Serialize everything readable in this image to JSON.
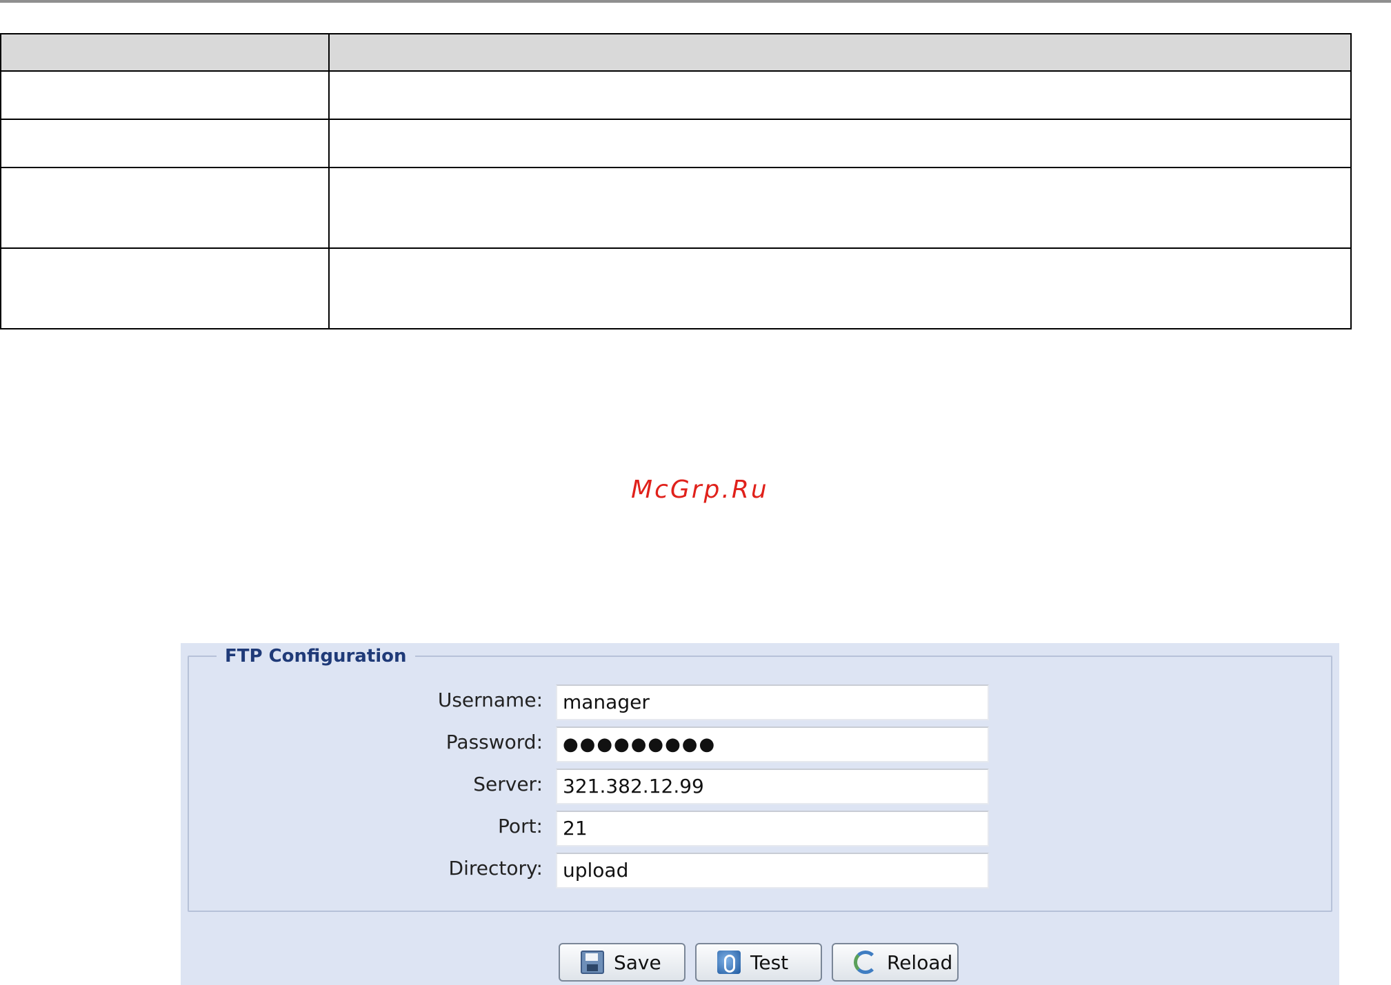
{
  "watermark": "McGrp.Ru",
  "table": {
    "header": [
      "",
      ""
    ],
    "rows": [
      [
        "",
        ""
      ],
      [
        "",
        ""
      ],
      [
        "",
        ""
      ],
      [
        "",
        ""
      ]
    ]
  },
  "ftp": {
    "legend": "FTP Configuration",
    "fields": [
      {
        "label": "Username:",
        "value": "manager"
      },
      {
        "label": "Password:",
        "value": "●●●●●●●●●"
      },
      {
        "label": "Server:",
        "value": "321.382.12.99"
      },
      {
        "label": "Port:",
        "value": "21"
      },
      {
        "label": "Directory:",
        "value": "upload"
      }
    ],
    "buttons": {
      "save": "Save",
      "test": "Test",
      "reload": "Reload"
    }
  },
  "colors": {
    "panel": "#dde4f3",
    "legend": "#1f3a78",
    "watermark": "#e0211b"
  }
}
